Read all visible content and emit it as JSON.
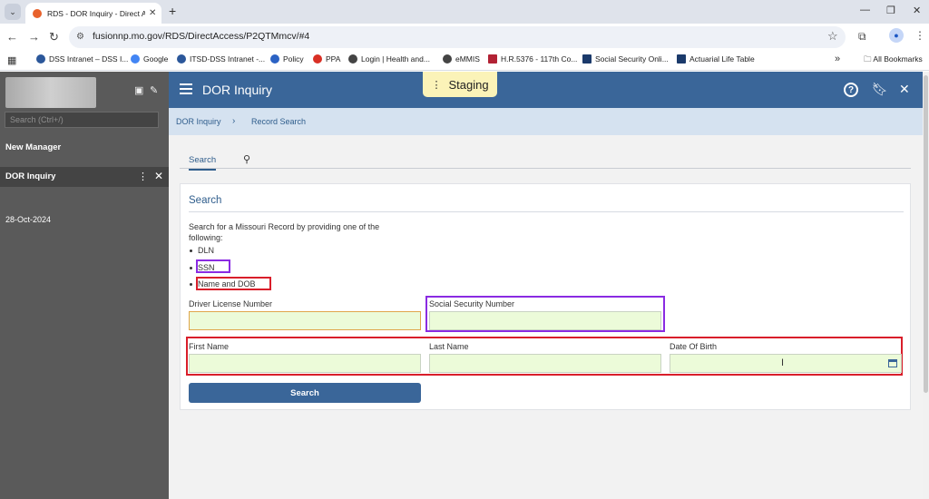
{
  "browser": {
    "tab_title": "RDS - DOR Inquiry - Direct Acce",
    "url": "fusionnp.mo.gov/RDS/DirectAccess/P2QTMmcv/#4",
    "bookmarks": [
      {
        "label": "DSS Intranet – DSS I...",
        "color": "#2b579a"
      },
      {
        "label": "Google",
        "color": "#4285f4"
      },
      {
        "label": "ITSD-DSS Intranet -...",
        "color": "#2b579a"
      },
      {
        "label": "Policy",
        "color": "#2b62c4"
      },
      {
        "label": "PPA",
        "color": "#d93025"
      },
      {
        "label": "Login | Health and...",
        "color": "#444444"
      },
      {
        "label": "eMMIS",
        "color": "#444444"
      },
      {
        "label": "H.R.5376 - 117th Co...",
        "color": "#b22234"
      },
      {
        "label": "Social Security Onli...",
        "color": "#1b3a6b"
      },
      {
        "label": "Actuarial Life Table",
        "color": "#1b3a6b"
      }
    ],
    "all_bookmarks": "All Bookmarks"
  },
  "sidepanel": {
    "search_placeholder": "Search (Ctrl+/)",
    "new_manager": "New Manager",
    "active_item": "DOR Inquiry",
    "date": "28-Oct-2024"
  },
  "header": {
    "title": "DOR Inquiry",
    "staging_label": "Staging",
    "accent": "#3a6699"
  },
  "breadcrumb": {
    "items": [
      "DOR Inquiry",
      "Record Search"
    ]
  },
  "tabs": {
    "search_label": "Search"
  },
  "search_card": {
    "title": "Search",
    "description": "Search for a Missouri Record by providing one of the following:",
    "options": [
      "DLN",
      "SSN",
      "Name and DOB"
    ],
    "fields": {
      "dln_label": "Driver License Number",
      "ssn_label": "Social Security Number",
      "first_name_label": "First Name",
      "last_name_label": "Last Name",
      "dob_label": "Date Of Birth"
    },
    "search_button": "Search"
  },
  "highlight_colors": {
    "purple": "#8a2be2",
    "red": "#d91e2a"
  }
}
